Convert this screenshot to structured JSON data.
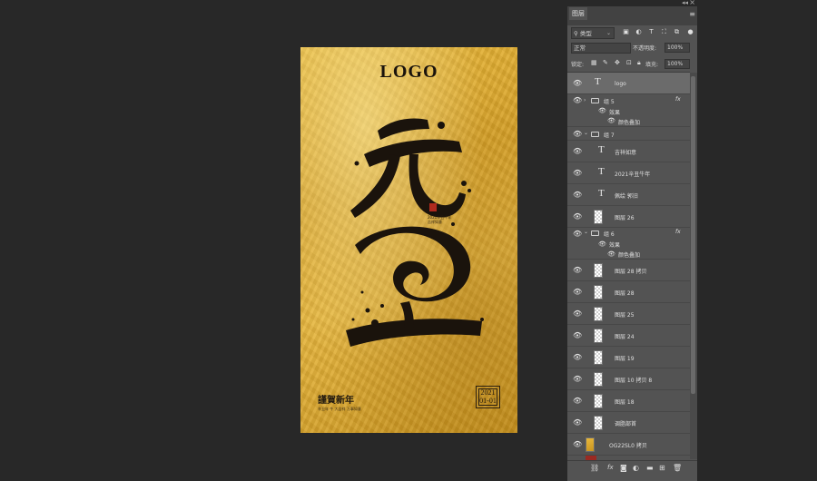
{
  "canvas": {
    "logo": "LOGO",
    "greeting": "謹賀新年",
    "greeting_sub": "辛丑年 牛 大吉祥 万事如意",
    "date_year": "2021",
    "date_day": "01-01",
    "caption": "2021辛丑牛年 吉祥如意"
  },
  "panel": {
    "tab": "图层",
    "filter": "类型",
    "blend_mode": "正常",
    "opacity_label": "不透明度:",
    "opacity": "100%",
    "lock_label": "锁定:",
    "fill_label": "填充:",
    "fill": "100%",
    "layers": [
      {
        "name": "logo"
      },
      {
        "name": "组 5"
      },
      {
        "name": "效果"
      },
      {
        "name": "颜色叠加"
      },
      {
        "name": "组 7"
      },
      {
        "name": "吉祥如意"
      },
      {
        "name": "2021辛丑牛年"
      },
      {
        "name": "佩绘 郭旧"
      },
      {
        "name": "图层 26"
      },
      {
        "name": "组 6"
      },
      {
        "name": "效果"
      },
      {
        "name": "颜色叠加"
      },
      {
        "name": "图层 28 拷贝"
      },
      {
        "name": "图层 28"
      },
      {
        "name": "图层 25"
      },
      {
        "name": "图层 24"
      },
      {
        "name": "图层 19"
      },
      {
        "name": "图层 10 拷贝 8"
      },
      {
        "name": "图层 18"
      },
      {
        "name": "调脂部首"
      },
      {
        "name": "OG22SL0 拷贝"
      }
    ],
    "fx_label": "fx",
    "colors": {
      "panel_bg": "#535353",
      "selected": "#6b6b6b",
      "gold": "#d9a62c",
      "ink": "#1a130c"
    }
  }
}
